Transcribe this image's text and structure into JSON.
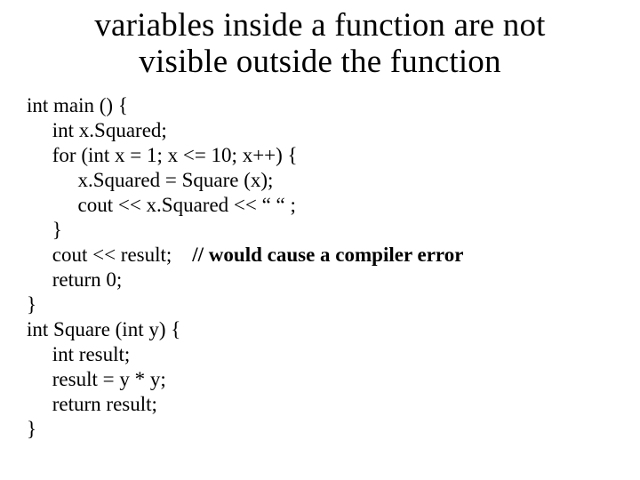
{
  "title_line1": "variables inside a function are not",
  "title_line2": "visible outside the function",
  "code": {
    "l01": "int main () {",
    "l02": "     int x.Squared;",
    "l03": "     for (int x = 1; x <= 10; x++) {",
    "l04": "          x.Squared = Square (x);",
    "l05": "          cout << x.Squared << “ “ ;",
    "l06": "     }",
    "l07a": "     cout << result;    ",
    "l07b": "// would cause a compiler error",
    "l08": "     return 0;",
    "l09": "}",
    "l10": "int Square (int y) {",
    "l11": "     int result;",
    "l12": "     result = y * y;",
    "l13": "     return result;",
    "l14": "}"
  }
}
